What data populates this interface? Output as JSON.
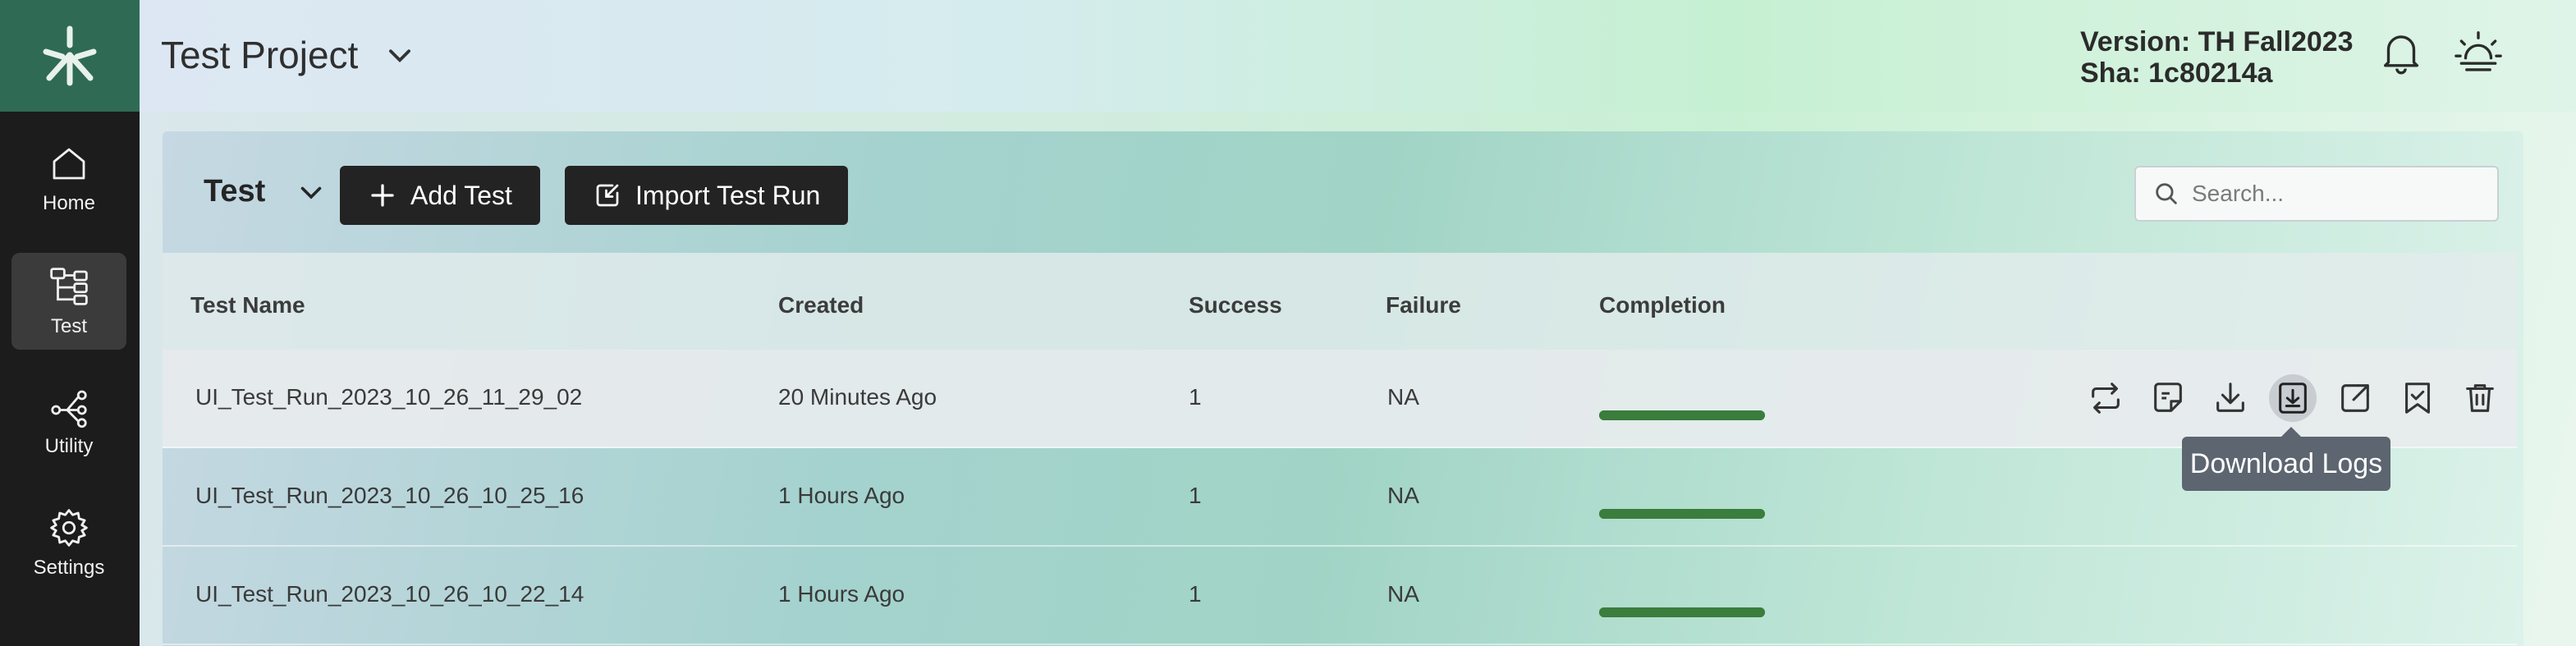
{
  "sidebar": {
    "items": [
      {
        "label": "Home",
        "icon": "home-icon"
      },
      {
        "label": "Test",
        "icon": "hierarchy-icon"
      },
      {
        "label": "Utility",
        "icon": "share-nodes-icon"
      },
      {
        "label": "Settings",
        "icon": "gear-icon"
      }
    ],
    "active": "Test"
  },
  "header": {
    "project": "Test Project",
    "version": "Version: TH Fall2023",
    "sha": "Sha: 1c80214a"
  },
  "toolbar": {
    "label": "Test",
    "add_button": "Add Test",
    "import_button": "Import Test Run",
    "search_placeholder": "Search..."
  },
  "table": {
    "columns": [
      "Test Name",
      "Created",
      "Success",
      "Failure",
      "Completion"
    ],
    "rows": [
      {
        "name": "UI_Test_Run_2023_10_26_11_29_02",
        "created": "20 Minutes Ago",
        "success": "1",
        "failure": "NA",
        "completion": 1.0
      },
      {
        "name": "UI_Test_Run_2023_10_26_10_25_16",
        "created": "1 Hours Ago",
        "success": "1",
        "failure": "NA",
        "completion": 1.0
      },
      {
        "name": "UI_Test_Run_2023_10_26_10_22_14",
        "created": "1 Hours Ago",
        "success": "1",
        "failure": "NA",
        "completion": 1.0
      }
    ],
    "row_actions": [
      "repeat-icon",
      "file-icon",
      "download-icon",
      "download-logs-icon",
      "external-link-icon",
      "bookmark-check-icon",
      "trash-icon"
    ]
  },
  "tooltip": "Download Logs",
  "colors": {
    "sidebar_bg": "#1c1c1c",
    "logo_bg": "#2f6a55",
    "button_bg": "#232323",
    "progress": "#3a7d3c",
    "tooltip_bg": "#5c6570"
  }
}
